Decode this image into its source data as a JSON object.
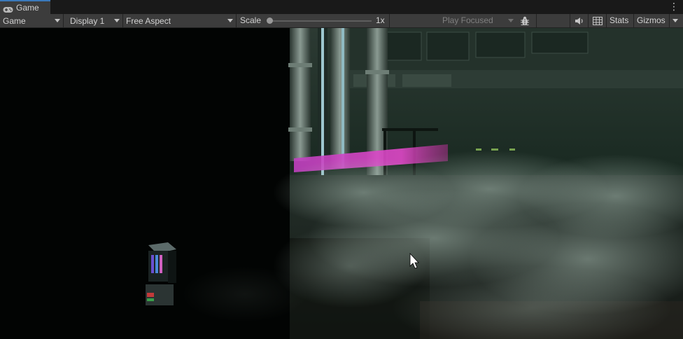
{
  "tab": {
    "label": "Game",
    "icon": "gamepad-icon"
  },
  "toolbar": {
    "view_mode": "Game",
    "display": "Display 1",
    "aspect": "Free Aspect",
    "scale_label": "Scale",
    "scale_value": "1x",
    "scale_slider_fraction": 0.0,
    "play_mode": "Play Focused",
    "stats_label": "Stats",
    "gizmos_label": "Gizmos"
  },
  "colors": {
    "accent": "#3a79bb",
    "neon_pink": "#e040d0",
    "panel": "#3c3c3c",
    "fog": "#9fb3a8"
  }
}
